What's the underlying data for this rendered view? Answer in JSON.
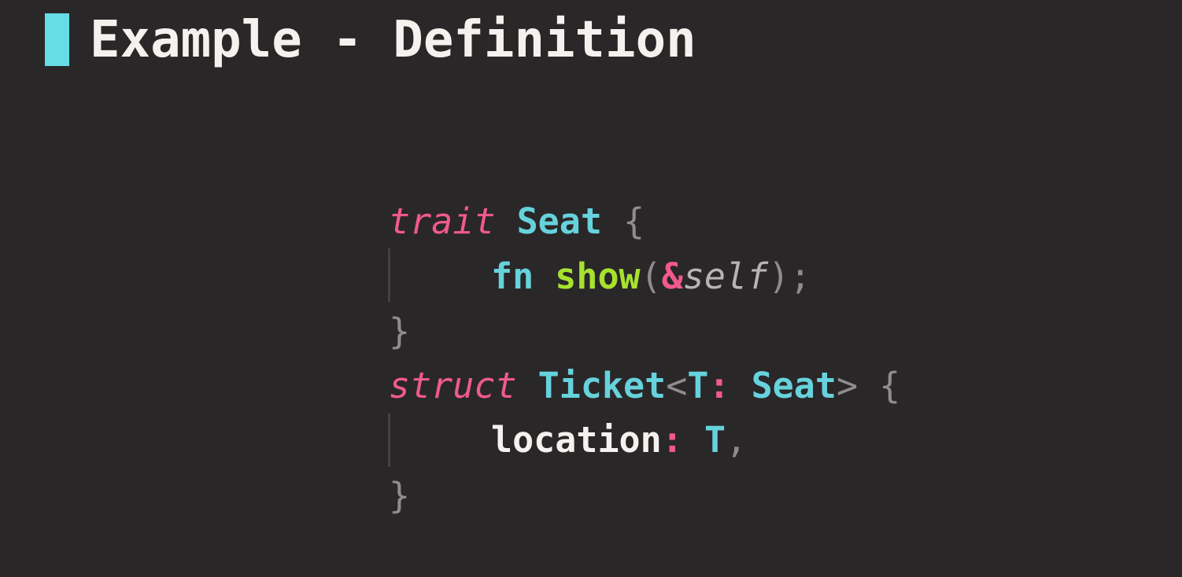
{
  "slide": {
    "title": "Example - Definition",
    "accent_color": "#66dde6",
    "background_color": "#2a2729"
  },
  "code": {
    "language": "rust",
    "line1": {
      "keyword": "trait",
      "name": "Seat",
      "brace": "{"
    },
    "line2": {
      "keyword": "fn",
      "name": "show",
      "paren_open": "(",
      "ref": "&",
      "self": "self",
      "paren_close": ")",
      "semicolon": ";"
    },
    "line3": {
      "brace": "}"
    },
    "line4": {
      "keyword": "struct",
      "name": "Ticket",
      "lt": "<",
      "param": "T",
      "colon": ":",
      "bound": "Seat",
      "gt": ">",
      "brace": "{"
    },
    "line5": {
      "field": "location",
      "colon": ":",
      "type": "T",
      "comma": ","
    },
    "line6": {
      "brace": "}"
    }
  }
}
